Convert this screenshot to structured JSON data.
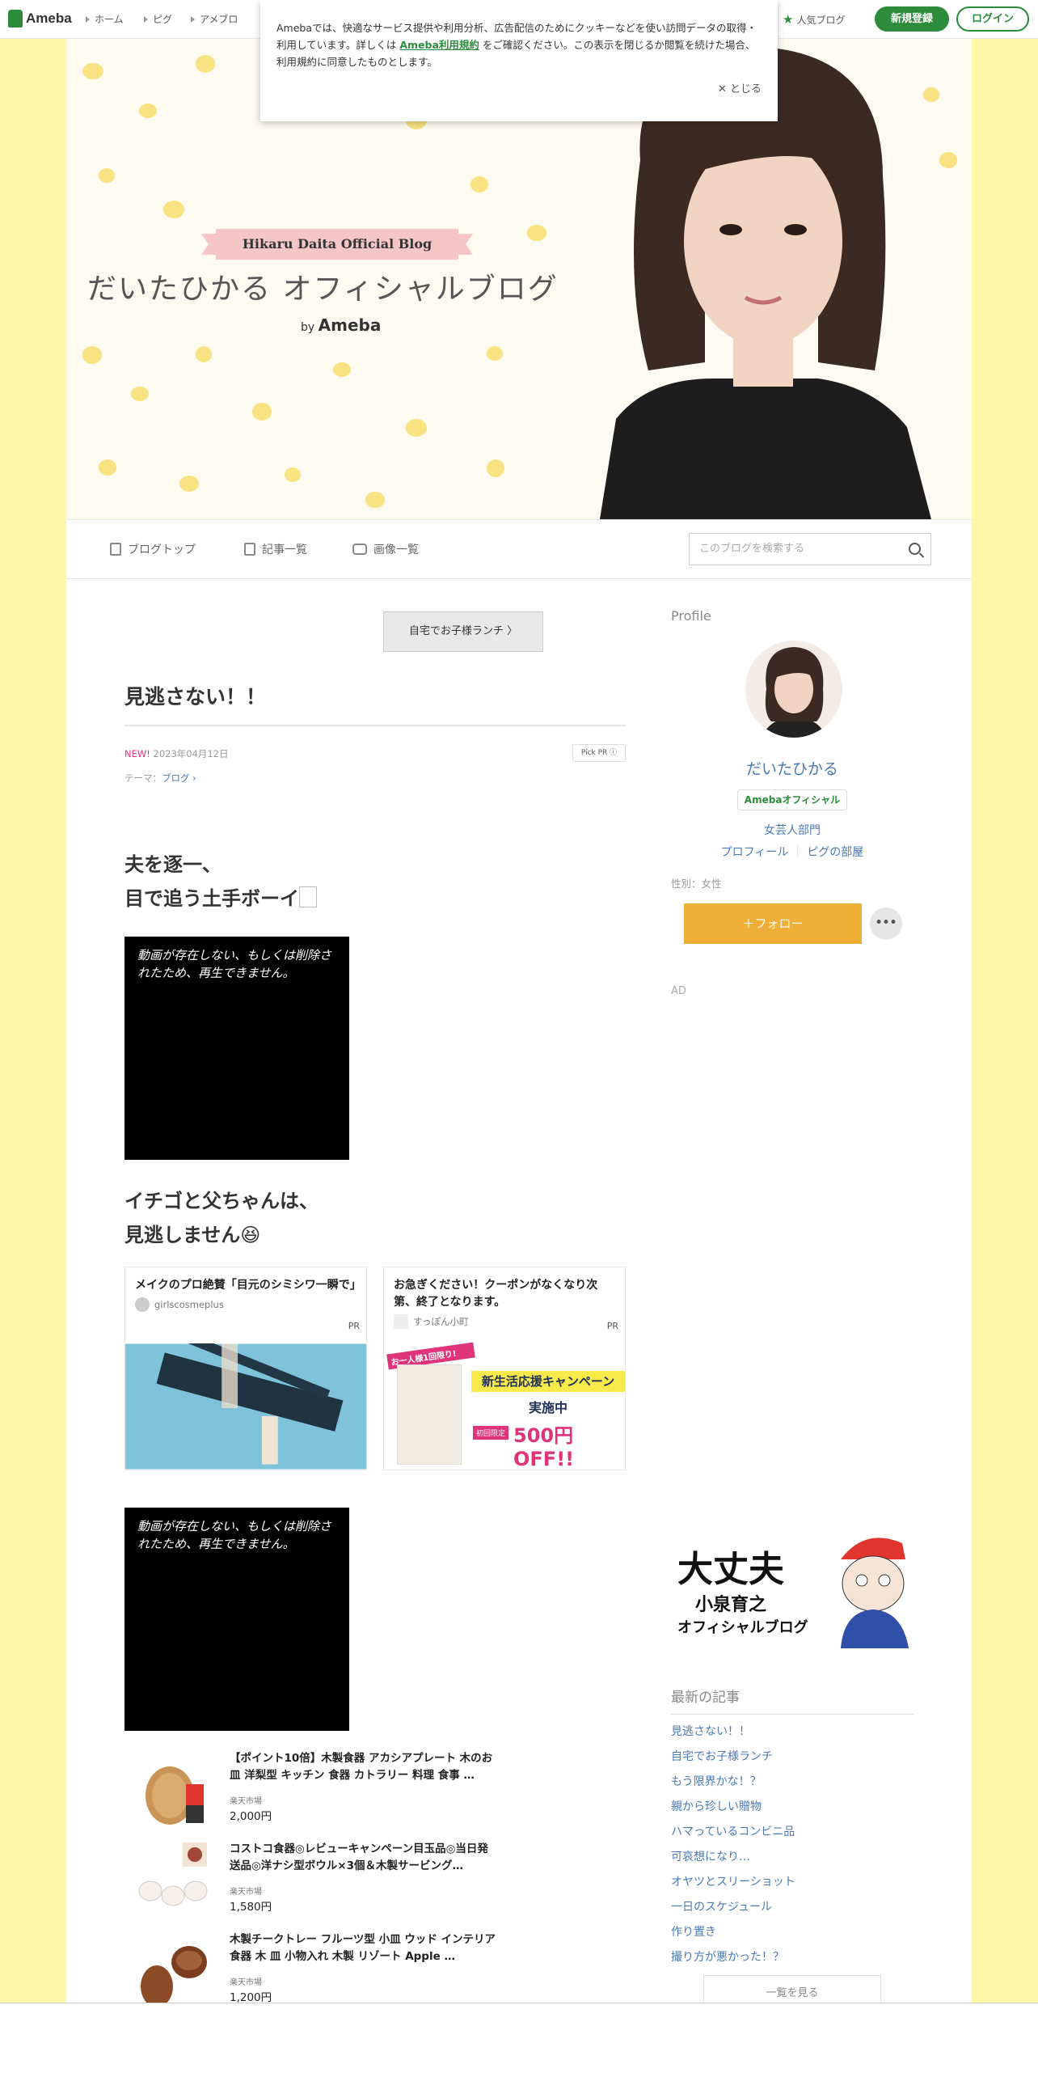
{
  "topbar": {
    "logo": "Ameba",
    "nav": [
      "ホーム",
      "ピグ",
      "アメブロ"
    ],
    "popular": "人気ブログ",
    "register": "新規登録",
    "login": "ログイン"
  },
  "cookie": {
    "text1": "Amebaでは、快適なサービス提供や利用分析、広告配信のためにクッキーなどを使い訪問データの取得・利用しています。詳しくは",
    "link": "Ameba利用規約",
    "text2": "をご確認ください。この表示を閉じるか閲覧を続けた場合、利用規約に同意したものとします。",
    "close": "とじる"
  },
  "header": {
    "ribbon": "Hikaru Daita Official Blog",
    "title": "だいたひかる オフィシャルブログ",
    "by": "by",
    "ameba": "Ameba"
  },
  "blognav": {
    "top": "ブログトップ",
    "list": "記事一覧",
    "images": "画像一覧",
    "search_placeholder": "このブログを検索する"
  },
  "entry": {
    "prev": "自宅でお子様ランチ",
    "title": "見逃さない！！",
    "new": "NEW!",
    "date": "2023年04月12日",
    "pickpr": "Pick PR ⓘ",
    "theme_label": "テーマ：",
    "theme": "ブログ",
    "para1_line1": "夫を逐一、",
    "para1_line2": "目で追う土手ボーイ",
    "video_msg": "動画が存在しない、もしくは削除されたため、再生できません。",
    "para2_line1": "イチゴと父ちゃんは、",
    "para2_line2": "見逃しません😆"
  },
  "ads": [
    {
      "title": "メイクのプロ絶賛「目元のシミシワ一瞬で」",
      "source": "girlscosmeplus",
      "pr": "PR"
    },
    {
      "title": "お急ぎください！クーポンがなくなり次第、終了となります。",
      "source": "すっぽん小町",
      "pr": "PR",
      "banner1": "お一人様1回限り!",
      "banner2": "新生活応援キャンペーン",
      "banner3": "実施中",
      "banner4": "初回限定",
      "banner5": "500円OFF!!"
    }
  ],
  "products": [
    {
      "name": "【ポイント10倍】木製食器 アカシアプレート 木のお皿 洋梨型 キッチン 食器 カトラリー 料理 食事 …",
      "shop": "楽天市場",
      "price": "2,000円"
    },
    {
      "name": "コストコ食器◎レビューキャンペーン目玉品◎当日発送品◎洋ナシ型ボウル×3個＆木製サービング…",
      "shop": "楽天市場",
      "price": "1,580円"
    },
    {
      "name": "木製チークトレー フルーツ型 小皿 ウッド インテリア 食器 木 皿 小物入れ 木製 リゾート Apple …",
      "shop": "楽天市場",
      "price": "1,200円"
    }
  ],
  "sidebar": {
    "profile_heading": "Profile",
    "name": "だいたひかる",
    "official": "Amebaオフィシャル",
    "dept": "女芸人部門",
    "profile_link": "プロフィール",
    "pig_link": "ピグの部屋",
    "gender": "性別：女性",
    "follow": "＋フォロー",
    "more": "•••",
    "ad": "AD",
    "banner_line1": "大丈夫",
    "banner_line2": "小泉育之",
    "banner_line3": "オフィシャルブログ",
    "latest_heading": "最新の記事",
    "latest": [
      "見逃さない！！",
      "自宅でお子様ランチ",
      "もう限界かな！？",
      "親から珍しい贈物",
      "ハマっているコンビニ品",
      "可哀想になり…",
      "オヤツとスリーショット",
      "一日のスケジュール",
      "作り置き",
      "撮り方が悪かった！？"
    ],
    "see_all": "一覧を見る"
  },
  "colors": {
    "brand_green": "#2d8c3c",
    "follow": "#efae35",
    "link": "#4a7ab5",
    "bg_yellow": "#fff6a7"
  }
}
